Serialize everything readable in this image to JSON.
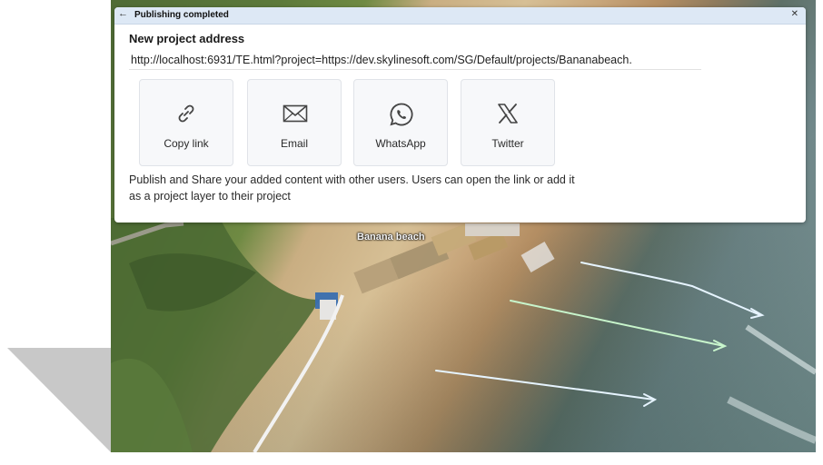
{
  "dialog": {
    "title": "Publishing completed",
    "heading": "New project address",
    "url": "http://localhost:6931/TE.html?project=https://dev.skylinesoft.com/SG/Default/projects/Bananabeach.",
    "description": "Publish and Share your added content with other users. Users can open the link or add it as a project layer to their project",
    "share_options": [
      {
        "label": "Copy link",
        "icon": "link-icon"
      },
      {
        "label": "Email",
        "icon": "email-icon"
      },
      {
        "label": "WhatsApp",
        "icon": "whatsapp-icon"
      },
      {
        "label": "Twitter",
        "icon": "x-twitter-icon"
      }
    ]
  },
  "map": {
    "place_label": "Banana beach"
  },
  "colors": {
    "titlebar": "#dde8f5",
    "button_bg": "#f7f8fa",
    "arrow_white": "#e6f4ff",
    "arrow_green": "#c8f5cc"
  }
}
